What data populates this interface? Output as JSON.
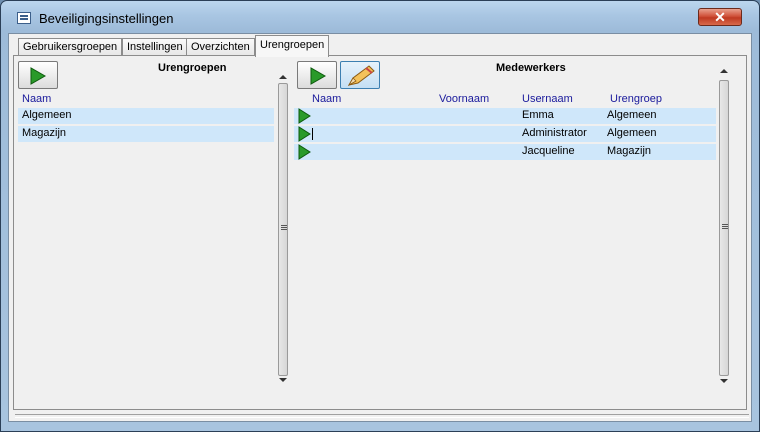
{
  "window": {
    "title": "Beveiligingsinstellingen",
    "close_glyph": "✕"
  },
  "tabs": [
    "Gebruikersgroepen",
    "Instellingen",
    "Overzichten",
    "Urengroepen"
  ],
  "left_panel": {
    "heading": "Urengroepen",
    "column": "Naam",
    "rows": [
      "Algemeen",
      "Magazijn"
    ]
  },
  "right_panel": {
    "heading": "Medewerkers",
    "columns": {
      "naam": "Naam",
      "voornaam": "Voornaam",
      "username": "Usernaam",
      "urengroep": "Urengroep"
    },
    "rows": [
      {
        "naam": "",
        "voornaam": "",
        "username": "Emma",
        "urengroep": "Algemeen"
      },
      {
        "naam": "",
        "voornaam": "",
        "username": "Administrator",
        "urengroep": "Algemeen"
      },
      {
        "naam": "",
        "voornaam": "",
        "username": "Jacqueline",
        "urengroep": "Magazijn"
      }
    ]
  },
  "icons": {
    "new": "green-play-icon",
    "edit": "pencil-icon",
    "row_selector": "row-arrow-icon"
  },
  "colors": {
    "row_highlight": "#cfe7fa",
    "column_header": "#1a1a9c",
    "arrow_green": "#2a9a2a"
  }
}
